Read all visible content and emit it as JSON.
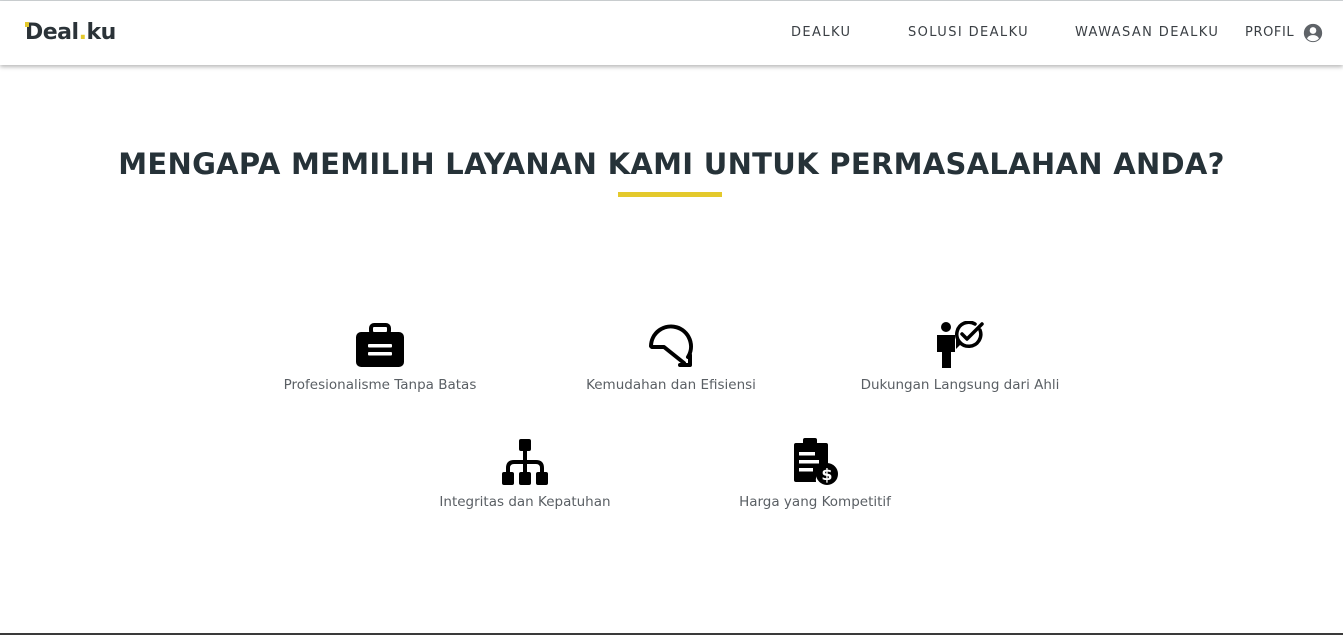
{
  "nav": {
    "logo_text_d": "D",
    "logo_text_mid": "eal",
    "logo_text_dot": ".",
    "logo_text_end": "ku",
    "links": [
      {
        "label": "DEALKU"
      },
      {
        "label": "SOLUSI DEALKU"
      },
      {
        "label": "WAWASAN DEALKU"
      },
      {
        "label": "PROFIL"
      }
    ],
    "profile_icon": "account-circle-icon"
  },
  "section": {
    "title": "MENGAPA MEMILIH LAYANAN KAMI UNTUK PERMASALAHAN ANDA?",
    "features": [
      {
        "label": "Profesionalisme Tanpa Batas",
        "icon": "briefcase-icon"
      },
      {
        "label": "Kemudahan dan Efisiensi",
        "icon": "rotate-arrow-icon"
      },
      {
        "label": "Dukungan Langsung dari Ahli",
        "icon": "person-check-icon"
      },
      {
        "label": "Integritas dan Kepatuhan",
        "icon": "hierarchy-icon"
      },
      {
        "label": "Harga yang Kompetitif",
        "icon": "clipboard-dollar-icon"
      }
    ]
  },
  "colors": {
    "accent": "#e4c92c",
    "heading": "#263238",
    "text": "#5a5f64"
  }
}
